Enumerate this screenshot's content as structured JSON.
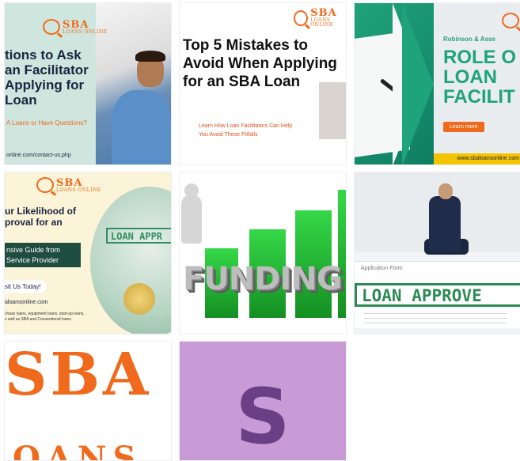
{
  "grid": {
    "tiles": [
      {
        "logo_sba": "SBA",
        "logo_sub": "LOANS ONLINE",
        "title": "tions to Ask\nan Facilitator\nApplying for\nLoan",
        "question": "A Loans or Have Questions?",
        "url": "online.com/contact-us.php"
      },
      {
        "logo_sba": "SBA",
        "logo_sub": "LOANS ONLINE",
        "title": "Top 5 Mistakes to\nAvoid When Applying\nfor an SBA Loan",
        "subtitle": "Learn How Loan Facilitators Can Help\nYou Avoid These Pitfalls"
      },
      {
        "company": "Robinson & Asse",
        "title": "ROLE O\nLOAN\nFACILIT",
        "button": "Learn more",
        "footer": "www.sbaloansonline.com"
      },
      {
        "logo_sba": "SBA",
        "logo_sub": "LOANS ONLINE",
        "title": "ur Likelihood of\nproval for an",
        "guide": "nsive Guide from\nService Provider",
        "visit": "sit Us Today!",
        "url": "aloansonline.com",
        "small_text": "chase loans, equipment loans, start-up loans,\ns well as SBA and Conventional loans",
        "stamp": "LOAN APPR"
      },
      {
        "word": "FUNDING"
      },
      {
        "form_title": "Application Form",
        "stamp": "LOAN APPROVE"
      },
      {
        "big_text": "SBA",
        "big_text_2": "OANS"
      },
      {
        "letter": "S"
      }
    ]
  },
  "colors": {
    "brand_orange": "#f06a1e",
    "navy": "#1c2340",
    "green": "#1fa37a",
    "purple_bg": "#c89ad6",
    "purple_letter": "#6b3f86"
  }
}
